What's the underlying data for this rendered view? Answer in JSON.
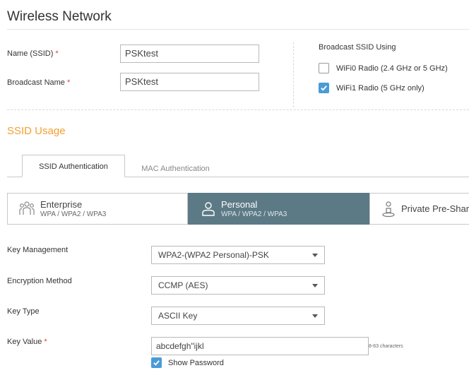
{
  "page": {
    "title": "Wireless Network"
  },
  "form": {
    "name_label": "Name (SSID)",
    "name_value": "PSKtest",
    "broadcast_label": "Broadcast Name",
    "broadcast_value": "PSKtest",
    "required_mark": "*"
  },
  "broadcast_using": {
    "title": "Broadcast SSID Using",
    "options": [
      {
        "label": "WiFi0 Radio (2.4 GHz or 5 GHz)",
        "checked": false
      },
      {
        "label": "WiFi1 Radio (5 GHz only)",
        "checked": true
      }
    ]
  },
  "ssid_usage": {
    "title": "SSID Usage",
    "tabs": [
      {
        "label": "SSID Authentication",
        "active": true
      },
      {
        "label": "MAC Authentication",
        "active": false
      }
    ],
    "auth_types": [
      {
        "label": "Enterprise",
        "sub": "WPA / WPA2 / WPA3",
        "selected": false
      },
      {
        "label": "Personal",
        "sub": "WPA / WPA2 / WPA3",
        "selected": true
      },
      {
        "label": "Private Pre-Shar",
        "sub": "",
        "selected": false
      }
    ]
  },
  "settings": {
    "key_management": {
      "label": "Key Management",
      "value": "WPA2-(WPA2 Personal)-PSK"
    },
    "encryption_method": {
      "label": "Encryption Method",
      "value": "CCMP (AES)"
    },
    "key_type": {
      "label": "Key Type",
      "value": "ASCII Key"
    },
    "key_value": {
      "label": "Key Value",
      "value": "abcdefgh\"ijkl",
      "hint": "8-63 characters"
    },
    "show_password": {
      "label": "Show Password",
      "checked": true
    }
  },
  "colors": {
    "accent_orange": "#f0a030",
    "checkbox_blue": "#4a9bd6",
    "selected_tile": "#5c7a86",
    "required_red": "#e04040"
  }
}
